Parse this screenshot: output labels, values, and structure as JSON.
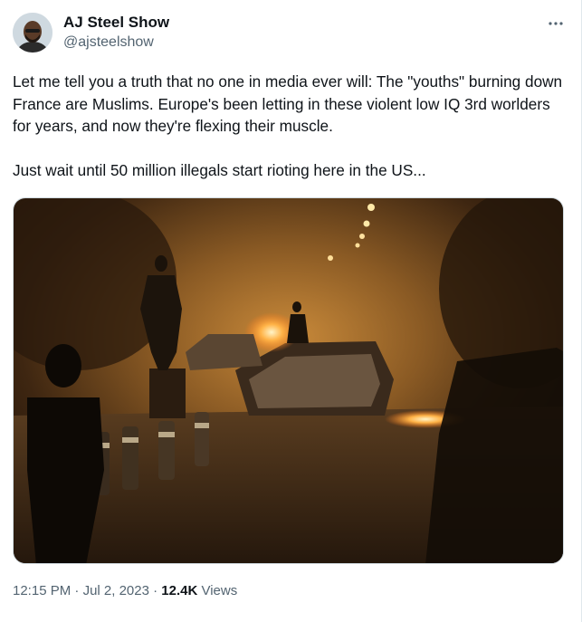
{
  "author": {
    "display_name": "AJ Steel Show",
    "handle": "@ajsteelshow"
  },
  "menu": {
    "icon": "more-horizontal-icon"
  },
  "tweet": {
    "paragraph1": "Let me tell you a truth that no one in media ever will: The \"youths\" burning down France are Muslims. Europe's been letting in these violent low IQ 3rd worlders for years, and now they're flexing their muscle.",
    "paragraph2": "Just wait until 50 million illegals start rioting here in the US..."
  },
  "meta": {
    "time": "12:15 PM",
    "separator1": " · ",
    "date": "Jul 2, 2023",
    "separator2": " · ",
    "views_count": "12.4K",
    "views_label": " Views"
  },
  "colors": {
    "text": "#0f1419",
    "secondary": "#536471",
    "fire": "#ff9a2e"
  }
}
